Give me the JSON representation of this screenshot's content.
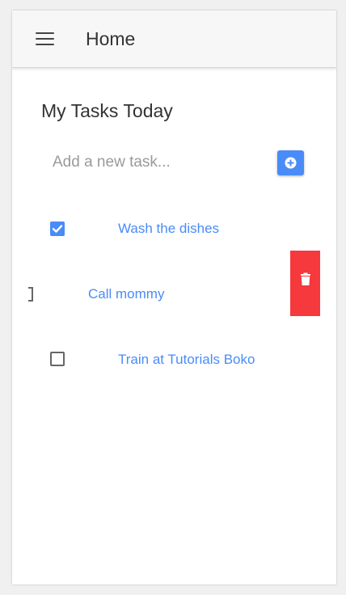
{
  "header": {
    "title": "Home",
    "menu_icon": "hamburger-menu-icon"
  },
  "section": {
    "title": "My Tasks Today"
  },
  "new_task": {
    "placeholder": "Add a new task...",
    "value": "",
    "add_icon": "plus-circle-icon"
  },
  "tasks": [
    {
      "label": "Wash the dishes",
      "checked": true
    },
    {
      "label": "Call mommy",
      "checked": false,
      "swiped": true
    },
    {
      "label": "Train at Tutorials Boko",
      "checked": false
    }
  ],
  "delete": {
    "icon": "trash-icon"
  },
  "colors": {
    "accent": "#4a8cf7",
    "danger": "#f5393d",
    "header_bg": "#f7f7f7",
    "text": "#333333"
  }
}
